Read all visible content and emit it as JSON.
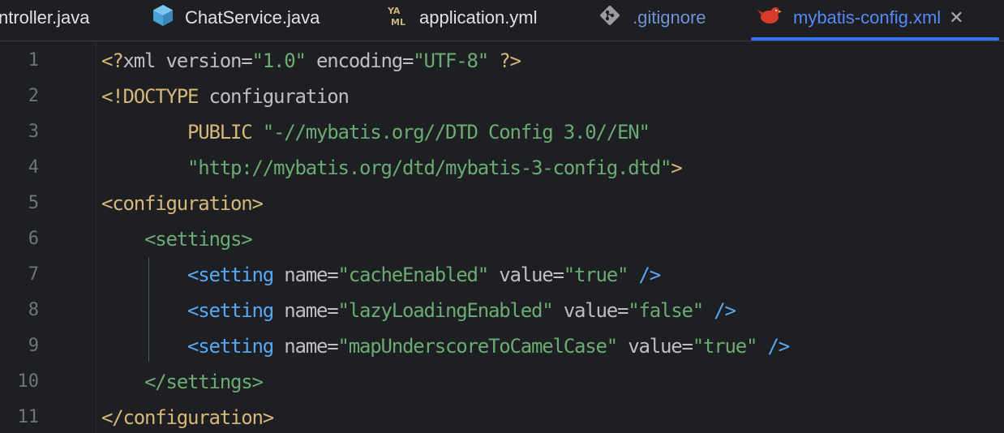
{
  "tabs": [
    {
      "label": "ntroller.java",
      "icon": "none",
      "active": false
    },
    {
      "label": "ChatService.java",
      "icon": "java-class-icon",
      "active": false
    },
    {
      "label": "application.yml",
      "icon": "yaml-icon",
      "active": false
    },
    {
      "label": ".gitignore",
      "icon": "git-icon",
      "active": false
    },
    {
      "label": "mybatis-config.xml",
      "icon": "mybatis-bird-icon",
      "active": true
    }
  ],
  "close_glyph": "✕",
  "colors": {
    "accent": "#3574f0",
    "background": "#1e1f22",
    "tag": "#d5b778",
    "string": "#6aab73",
    "element": "#56a8f5"
  },
  "line_numbers": [
    "1",
    "2",
    "3",
    "4",
    "5",
    "6",
    "7",
    "8",
    "9",
    "10",
    "11"
  ],
  "code": {
    "l1": {
      "open": "<?",
      "name": "xml",
      "a1": " version=",
      "v1": "\"1.0\"",
      "a2": " encoding=",
      "v2": "\"UTF-8\"",
      "close": " ?>"
    },
    "l2": {
      "tag": "<!DOCTYPE",
      "rest": " configuration"
    },
    "l3": {
      "indent": "        ",
      "kw": "PUBLIC",
      "sp": " ",
      "str": "\"-//mybatis.org//DTD Config 3.0//EN\""
    },
    "l4": {
      "indent": "        ",
      "str": "\"http://mybatis.org/dtd/mybatis-3-config.dtd\"",
      "close": ">"
    },
    "l5": {
      "tag": "<configuration>"
    },
    "l6": {
      "indent": "    ",
      "tag": "<settings>"
    },
    "l7": {
      "indent": "        ",
      "tag": "<setting",
      "a1": " name=",
      "v1": "\"cacheEnabled\"",
      "a2": " value=",
      "v2": "\"true\"",
      "close": " />"
    },
    "l8": {
      "indent": "        ",
      "tag": "<setting",
      "a1": " name=",
      "v1": "\"lazyLoadingEnabled\"",
      "a2": " value=",
      "v2": "\"false\"",
      "close": " />"
    },
    "l9": {
      "indent": "        ",
      "tag": "<setting",
      "a1": " name=",
      "v1": "\"mapUnderscoreToCamelCase\"",
      "a2": " value=",
      "v2": "\"true\"",
      "close": " />"
    },
    "l10": {
      "indent": "    ",
      "tag": "</settings>"
    },
    "l11": {
      "tag": "</configuration>"
    }
  }
}
